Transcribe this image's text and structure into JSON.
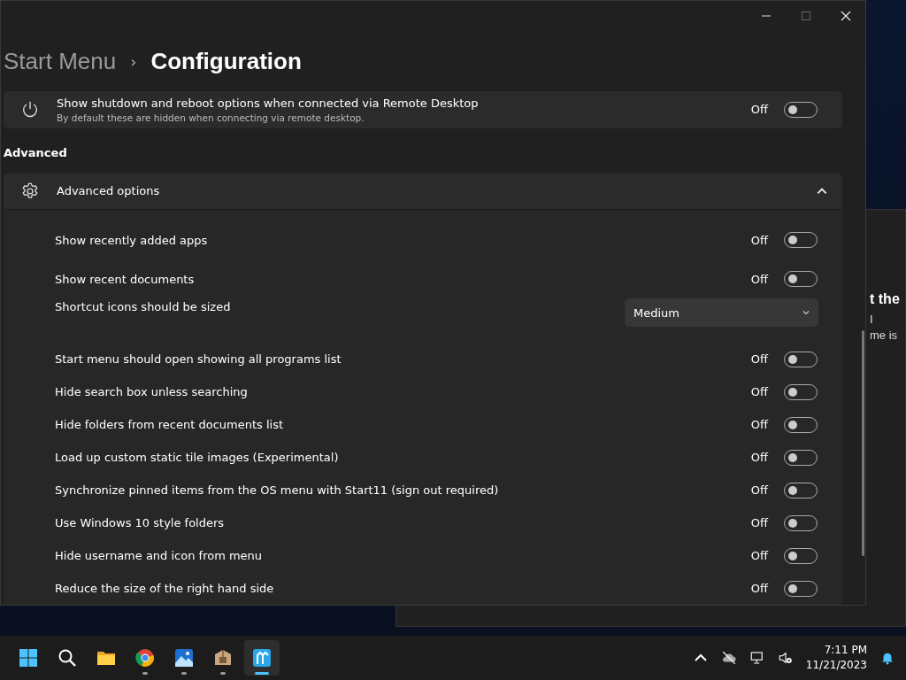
{
  "background_window": {
    "lines": [
      {
        "text": "t the",
        "kind": "heading"
      },
      {
        "text": "I",
        "kind": "body"
      },
      {
        "text": "me is",
        "kind": "body"
      }
    ]
  },
  "window": {
    "breadcrumb": [
      {
        "label": "Start Menu",
        "current": false
      },
      {
        "label": "Configuration",
        "current": true
      }
    ],
    "separator": "›",
    "top_setting": {
      "title": "Show shutdown and reboot options when connected via Remote Desktop",
      "description": "By default these are hidden when connecting via remote desktop.",
      "state_label": "Off",
      "on": false
    },
    "section_heading": "Advanced",
    "expander": {
      "title": "Advanced options",
      "expanded": true
    },
    "settings": [
      {
        "kind": "toggle",
        "label": "Show recently added apps",
        "state_label": "Off",
        "on": false
      },
      {
        "kind": "toggle",
        "label": "Show recent documents",
        "state_label": "Off",
        "on": false
      },
      {
        "kind": "dropdown",
        "label": "Shortcut icons should be sized",
        "value": "Medium"
      },
      {
        "kind": "toggle",
        "label": "Start menu should open showing all programs list",
        "state_label": "Off",
        "on": false
      },
      {
        "kind": "toggle",
        "label": "Hide search box unless searching",
        "state_label": "Off",
        "on": false
      },
      {
        "kind": "toggle",
        "label": "Hide folders from recent documents list",
        "state_label": "Off",
        "on": false
      },
      {
        "kind": "toggle",
        "label": "Load up custom static tile images (Experimental)",
        "state_label": "Off",
        "on": false
      },
      {
        "kind": "toggle",
        "label": "Synchronize pinned items from the OS menu with Start11 (sign out required)",
        "state_label": "Off",
        "on": false
      },
      {
        "kind": "toggle",
        "label": "Use Windows 10 style folders",
        "state_label": "Off",
        "on": false
      },
      {
        "kind": "toggle",
        "label": "Hide username and icon from menu",
        "state_label": "Off",
        "on": false
      },
      {
        "kind": "toggle",
        "label": "Reduce the size of the right hand side",
        "state_label": "Off",
        "on": false
      }
    ]
  },
  "taskbar": {
    "apps": [
      {
        "kind": "start",
        "running": false,
        "selected": false
      },
      {
        "kind": "search",
        "running": false,
        "selected": false
      },
      {
        "kind": "folder",
        "running": false,
        "selected": false
      },
      {
        "kind": "browser",
        "running": true,
        "selected": false
      },
      {
        "kind": "photos",
        "running": true,
        "selected": false
      },
      {
        "kind": "package",
        "running": true,
        "selected": false
      },
      {
        "kind": "app",
        "running": true,
        "selected": true
      }
    ],
    "time": "7:11 PM",
    "date": "11/21/2023"
  }
}
